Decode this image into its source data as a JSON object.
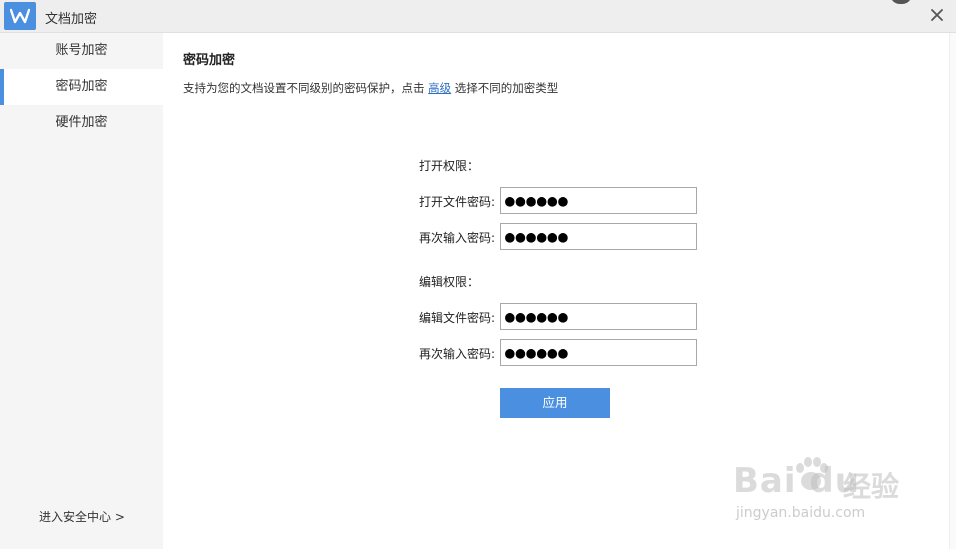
{
  "window": {
    "title": "文档加密"
  },
  "sidebar": {
    "items": [
      {
        "label": "账号加密",
        "active": false
      },
      {
        "label": "密码加密",
        "active": true
      },
      {
        "label": "硬件加密",
        "active": false
      }
    ],
    "security_center": "进入安全中心 >"
  },
  "main": {
    "title": "密码加密",
    "description_before": "支持为您的文档设置不同级别的密码保护，点击 ",
    "description_link": "高级",
    "description_after": " 选择不同的加密类型",
    "open_section": {
      "label": "打开权限：",
      "password_label": "打开文件密码:",
      "password_value": "●●●●●●",
      "confirm_label": "再次输入密码:",
      "confirm_value": "●●●●●●"
    },
    "edit_section": {
      "label": "编辑权限：",
      "password_label": "编辑文件密码:",
      "password_value": "●●●●●●",
      "confirm_label": "再次输入密码:",
      "confirm_value": "●●●●●●"
    },
    "apply_label": "应用"
  },
  "watermark": {
    "brand": "Bai du",
    "brand_cn": "经验",
    "url": "jingyan.baidu.com"
  },
  "colors": {
    "accent": "#4a8fe0",
    "link": "#2b6fc4",
    "sidebar_bg": "#f5f5f5"
  }
}
